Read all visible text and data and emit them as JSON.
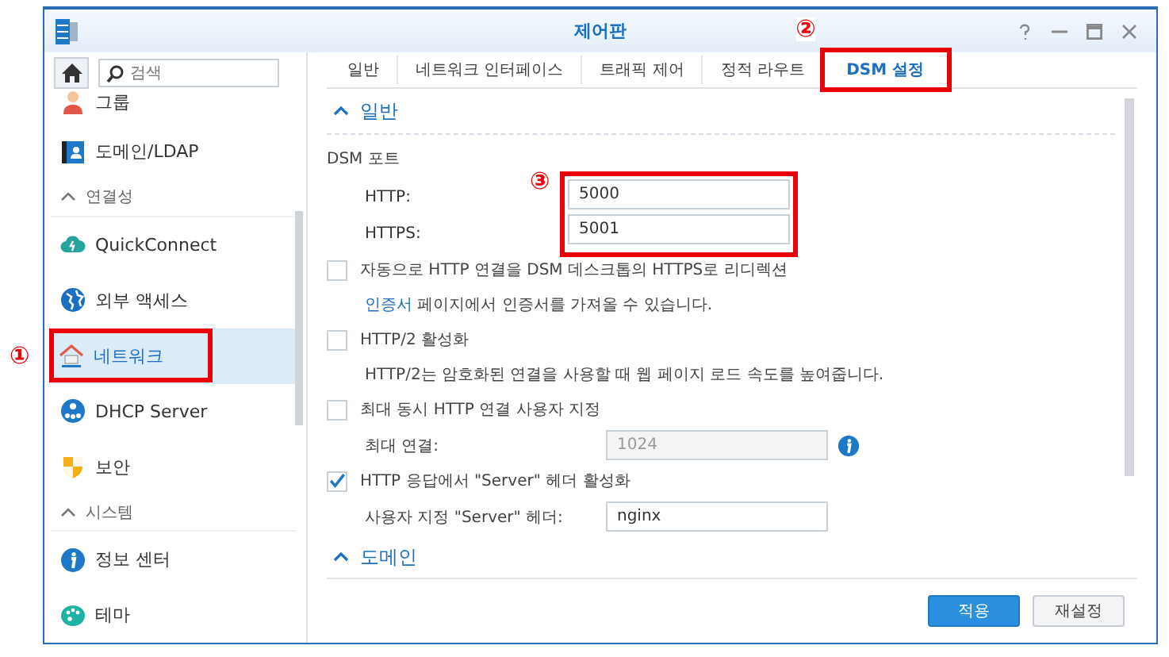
{
  "window": {
    "title": "제어판"
  },
  "sidebar": {
    "search": {
      "placeholder": "검색"
    },
    "items": [
      {
        "kind": "item",
        "label": "그룹",
        "selected": false
      },
      {
        "kind": "item",
        "label": "도메인/LDAP",
        "selected": false
      },
      {
        "kind": "header",
        "label": "연결성",
        "expanded": true
      },
      {
        "kind": "item",
        "label": "QuickConnect",
        "selected": false
      },
      {
        "kind": "item",
        "label": "외부 액세스",
        "selected": false
      },
      {
        "kind": "item",
        "label": "네트워크",
        "selected": true,
        "callout": "①"
      },
      {
        "kind": "item",
        "label": "DHCP Server",
        "selected": false
      },
      {
        "kind": "item",
        "label": "보안",
        "selected": false
      },
      {
        "kind": "header",
        "label": "시스템",
        "expanded": true
      },
      {
        "kind": "item",
        "label": "정보 센터",
        "selected": false
      },
      {
        "kind": "item",
        "label": "테마",
        "selected": false
      }
    ]
  },
  "tabs": [
    {
      "label": "일반",
      "selected": false
    },
    {
      "label": "네트워크 인터페이스",
      "selected": false
    },
    {
      "label": "트래픽 제어",
      "selected": false
    },
    {
      "label": "정적 라우트",
      "selected": false
    },
    {
      "label": "DSM 설정",
      "selected": true,
      "callout": "②"
    }
  ],
  "sections": [
    {
      "title": "일반",
      "expanded": true,
      "rows": [
        {
          "kind": "label",
          "label": "DSM 포트"
        },
        {
          "kind": "fieldgroup",
          "callout": "③",
          "fields": [
            {
              "label": "HTTP:",
              "value": "5000"
            },
            {
              "label": "HTTPS:",
              "value": "5001"
            }
          ]
        },
        {
          "kind": "checkbox",
          "label": "자동으로 HTTP 연결을 DSM 데스크톱의 HTTPS로 리디렉션",
          "checked": false
        },
        {
          "kind": "note",
          "link": "인증서",
          "text": "페이지에서 인증서를 가져올 수 있습니다."
        },
        {
          "kind": "checkbox",
          "label": "HTTP/2 활성화",
          "checked": false
        },
        {
          "kind": "note",
          "text": "HTTP/2는 암호화된 연결을 사용할 때 웹 페이지 로드 속도를 높여줍니다."
        },
        {
          "kind": "checkbox",
          "label": "최대 동시 HTTP 연결 사용자 지정",
          "checked": false
        },
        {
          "kind": "field",
          "label": "최대 연결:",
          "value": "1024",
          "disabled": true,
          "info": true
        },
        {
          "kind": "checkbox",
          "label": "HTTP 응답에서 \"Server\" 헤더 활성화",
          "checked": true
        },
        {
          "kind": "field",
          "label": "사용자 지정 \"Server\" 헤더:",
          "value": "nginx",
          "disabled": false,
          "info": false
        }
      ]
    },
    {
      "title": "도메인",
      "expanded": true
    }
  ],
  "buttons": [
    {
      "label": "적용",
      "primary": true
    },
    {
      "label": "재설정",
      "primary": false
    }
  ]
}
